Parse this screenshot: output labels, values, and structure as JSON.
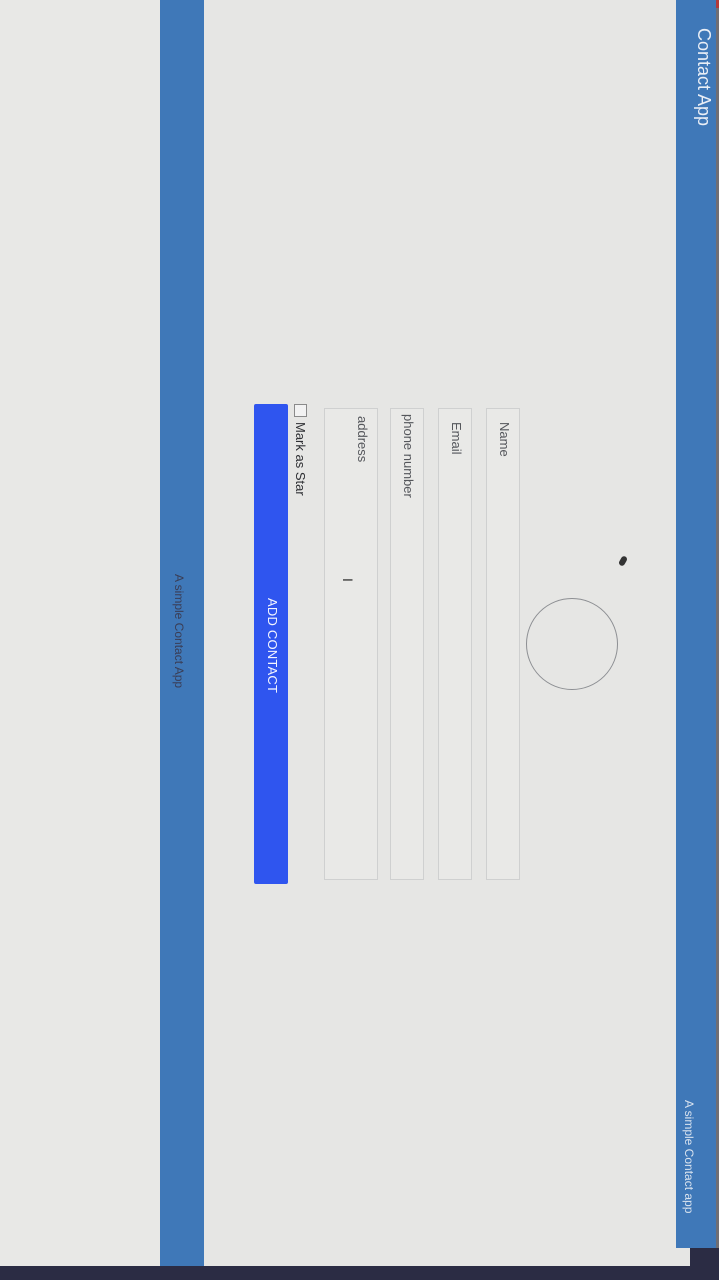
{
  "app": {
    "title": "Contact App",
    "subtitle": "A simple Contact app"
  },
  "form": {
    "name_placeholder": "Name",
    "email_placeholder": "Email",
    "phone_placeholder": "phone number",
    "address_placeholder": "address",
    "star_label": "Mark as Star",
    "submit_label": "ADD CONTACT"
  },
  "footer": {
    "text": "A simple Contact App"
  },
  "icons": {
    "avatar": "avatar-circle-icon",
    "cursor": "text-cursor-icon"
  },
  "colors": {
    "header": "#3f78b8",
    "button": "#2f55ef",
    "background": "#e6e6e4"
  }
}
